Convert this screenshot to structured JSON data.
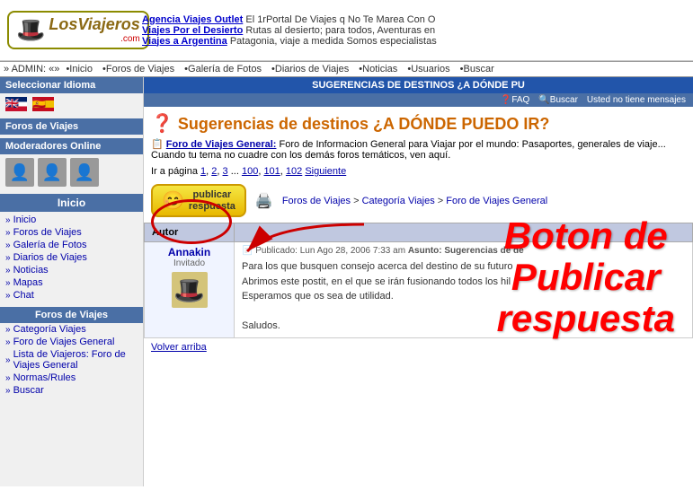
{
  "logo": {
    "hat": "🎩",
    "text": "LosViajeros",
    "com": ".com"
  },
  "ads": [
    {
      "link": "Agencia Viajes Outlet",
      "text": " El 1rPortal De Viajes q No Te Marea Con O"
    },
    {
      "link": "Viajes Por el Desierto",
      "text": " Rutas al desierto; para todos, Aventuras en"
    },
    {
      "link": "Viajes a Argentina",
      "text": " Patagonia, viaje a medida Somos especialistas"
    }
  ],
  "nav": {
    "admin_label": "» ADMIN:",
    "items": [
      "Inicio",
      "Foros de Viajes",
      "Galería de Fotos",
      "Diarios de Viajes",
      "Noticias",
      "Usuarios",
      "Buscar"
    ]
  },
  "sidebar": {
    "lang_label": "Seleccionar Idioma",
    "foros_label": "Foros de Viajes",
    "moderadores_label": "Moderadores Online",
    "inicio_label": "Inicio",
    "links": [
      "Inicio",
      "Foros de Viajes",
      "Galería de Fotos",
      "Diarios de Viajes",
      "Noticias",
      "Mapas",
      "Chat"
    ],
    "foros_section_label": "Foros de Viajes",
    "foros_links": [
      "Categoría Viajes",
      "Foro de Viajes General",
      "Lista de Viajeros: Foro de Viajes General",
      "Normas/Rules",
      "Buscar"
    ]
  },
  "content": {
    "header": "SUGERENCIAS DE DESTINOS ¿A DÓNDE PU",
    "subheader_items": [
      "FAQ",
      "Buscar",
      "Usted no tiene mensajes"
    ],
    "thread_title": "Sugerencias de destinos ¿A DÓNDE PUEDO IR?",
    "foro_desc_label": "Foro de Viajes General:",
    "foro_desc_text": " Foro de Informacion General para Viajar por el mundo: Pasaportes, generales de viaje... Cuando tu tema no cuadre con los demás foros temáticos, ven aquí.",
    "pagination": "Ir a página 1, 2, 3 ... 100, 101, 102  Siguiente",
    "publish_btn": "publicar\nrespuesta",
    "breadcrumb": "Foros de Viajes > Categoría Viajes > Foro de Viajes General",
    "table_header_autor": "Autor",
    "post": {
      "author_name": "Annakin",
      "author_role": "Invitado",
      "post_date": "Publicado: Lun Ago 28, 2006 7:33 am",
      "post_asunto": "Asunto:  Sugerencias de de",
      "body_lines": [
        "Para los que busquen consejo acerca del destino de su futuro",
        "Abrimos este postit, en el que se irán fusionando todos los hil",
        "Esperamos que os sea de utilidad.",
        "",
        "Saludos."
      ]
    },
    "volver_arriba": "Volver arriba"
  },
  "annotation": {
    "line1": "Boton de",
    "line2": "Publicar",
    "line3": "respuesta"
  }
}
